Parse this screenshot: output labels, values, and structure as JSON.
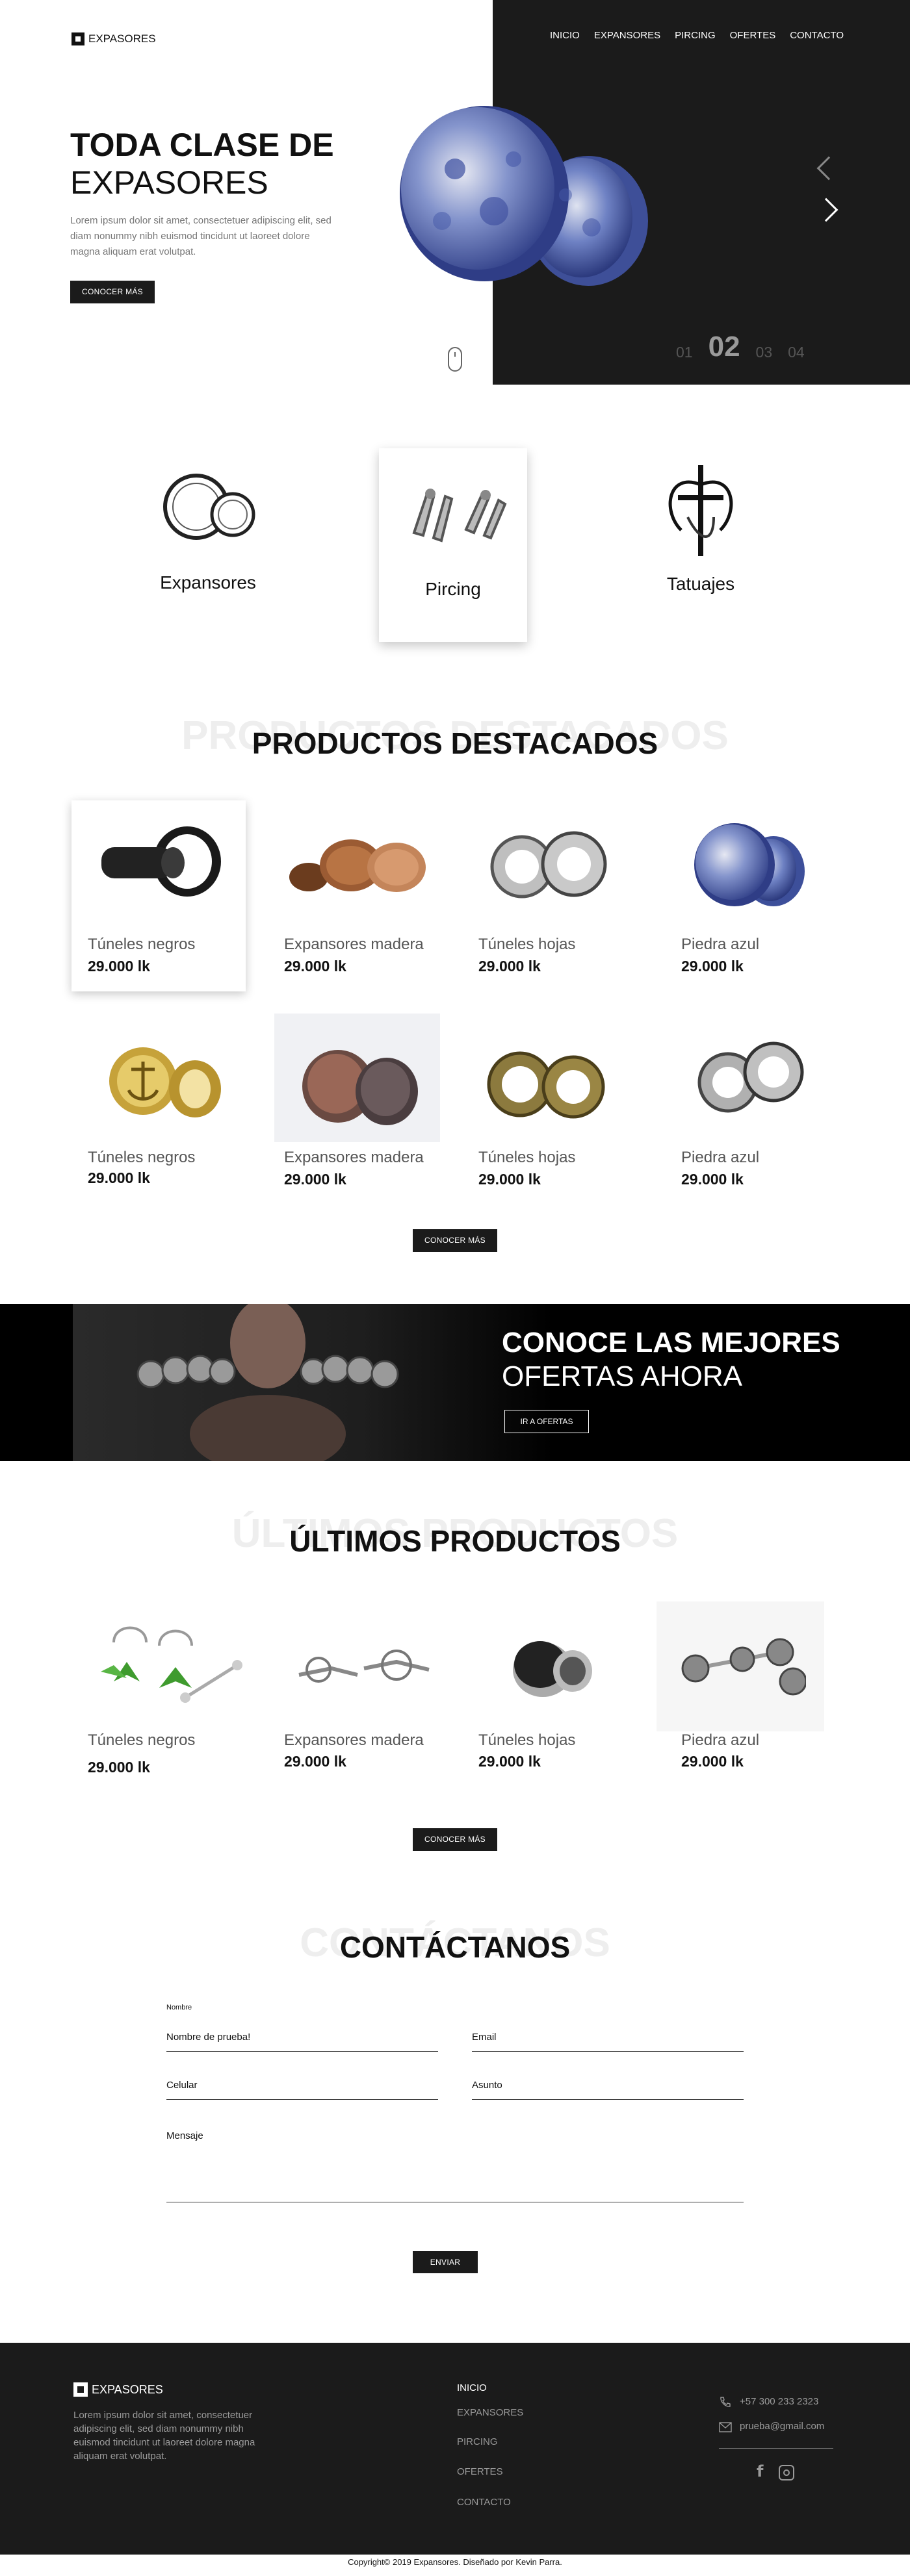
{
  "header": {
    "brand": "EXPASORES",
    "nav": [
      "INICIO",
      "EXPANSORES",
      "PIRCING",
      "OFERTES",
      "CONTACTO"
    ]
  },
  "hero": {
    "title_bold": "TODA CLASE DE",
    "title_light": "EXPASORES",
    "text": "Lorem ipsum dolor sit amet, consectetuer adipiscing elit, sed diam nonummy nibh euismod tincidunt ut laoreet dolore magna aliquam erat volutpat.",
    "button": "CONOCER MÁS",
    "slides": [
      "01",
      "02",
      "03",
      "04"
    ],
    "active_slide": "02",
    "product_color": "#4d63b6"
  },
  "categories": [
    {
      "label": "Expansores",
      "icon": "expansores-icon"
    },
    {
      "label": "Pircing",
      "icon": "pircing-icon"
    },
    {
      "label": "Tatuajes",
      "icon": "tatuajes-icon"
    }
  ],
  "featured": {
    "ghost": "PRODUCTOS DESTACADOS",
    "title": "PRODUCTOS DESTACADOS",
    "products": [
      {
        "name": "Túneles negros",
        "price": "29.000 lk"
      },
      {
        "name": "Expansores madera",
        "price": "29.000 lk"
      },
      {
        "name": "Túneles hojas",
        "price": "29.000 lk"
      },
      {
        "name": "Piedra azul",
        "price": "29.000 lk"
      },
      {
        "name": "Túneles negros",
        "price": "29.000 lk"
      },
      {
        "name": "Expansores madera",
        "price": "29.000 lk"
      },
      {
        "name": "Túneles hojas",
        "price": "29.000 lk"
      },
      {
        "name": "Piedra azul",
        "price": "29.000 lk"
      }
    ],
    "button": "CONOCER MÁS"
  },
  "offers": {
    "title_bold": "CONOCE LAS MEJORES",
    "title_light": "OFERTAS AHORA",
    "button": "IR A OFERTAS"
  },
  "latest": {
    "ghost": "ÚLTIMOS PRODUCTOS",
    "title": "ÚLTIMOS PRODUCTOS",
    "products": [
      {
        "name": "Túneles negros",
        "price": "29.000 lk"
      },
      {
        "name": "Expansores madera",
        "price": "29.000 lk"
      },
      {
        "name": "Túneles hojas",
        "price": "29.000 lk"
      },
      {
        "name": "Piedra azul",
        "price": "29.000 lk"
      }
    ],
    "button": "CONOCER MÁS"
  },
  "contact": {
    "ghost": "CONTÁCTANOS",
    "title": "CONTÁCTANOS",
    "small_label": "Nombre",
    "name_value": "Nombre de prueba!",
    "email": "Email",
    "phone": "Celular",
    "subject": "Asunto",
    "message": "Mensaje",
    "button": "ENVIAR"
  },
  "footer": {
    "brand": "EXPASORES",
    "text": "Lorem ipsum dolor sit amet, consectetuer adipiscing elit, sed diam nonummy nibh euismod tincidunt ut laoreet dolore magna aliquam erat volutpat.",
    "links": [
      "INICIO",
      "EXPANSORES",
      "PIRCING",
      "OFERTES",
      "CONTACTO"
    ],
    "phone": "+57 300 233 2323",
    "email": "prueba@gmail.com",
    "copyright": "Copyright© 2019 Expansores. Diseñado por Kevin Parra."
  }
}
